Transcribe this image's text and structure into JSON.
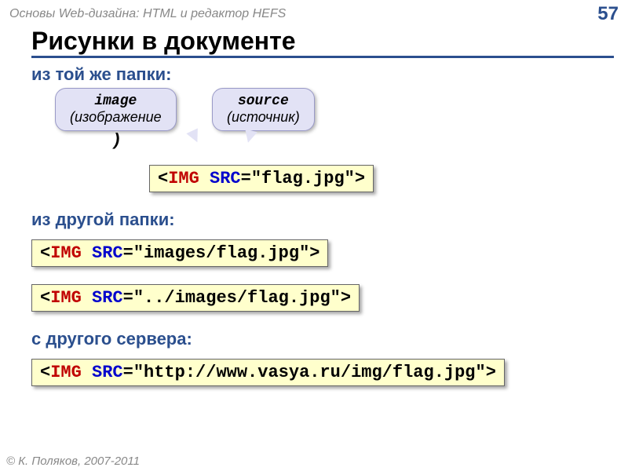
{
  "header": {
    "course": "Основы Web-дизайна: HTML и редактор HEFS",
    "page": "57"
  },
  "title": "Рисунки в документе",
  "sections": {
    "same_folder": "из той же папки:",
    "other_folder": "из другой папки:",
    "other_server": "с другого сервера:"
  },
  "callouts": {
    "image": {
      "term": "image",
      "trans": "(изображение"
    },
    "source": {
      "term": "source",
      "trans": "(источник)"
    },
    "closing_paren": ")"
  },
  "code": {
    "lt": "<",
    "gt": ">",
    "tag": "IMG",
    "attr": "SRC",
    "eq": "=",
    "v1": "\"flag.jpg\"",
    "v2": "\"images/flag.jpg\"",
    "v3": "\"../images/flag.jpg\"",
    "v4": "\"http://www.vasya.ru/img/flag.jpg\""
  },
  "footer": "© К. Поляков, 2007-2011"
}
